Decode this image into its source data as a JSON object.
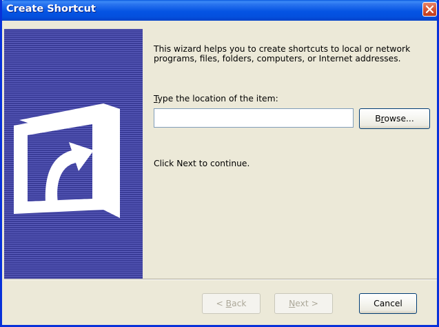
{
  "window": {
    "title": "Create Shortcut",
    "accent": "#0554e3",
    "close_color": "#d85a3a"
  },
  "banner": {
    "icon": "shortcut-arrow-icon",
    "color": "#3a3c98"
  },
  "main": {
    "intro": "This wizard helps you to create shortcuts to local or network programs, files, folders, computers, or Internet addresses.",
    "location_label_first": "T",
    "location_label_rest": "ype the location of the item:",
    "location_value": "",
    "browse_label_pre": "B",
    "browse_label_u": "r",
    "browse_label_post": "owse...",
    "continue_text": "Click Next to continue."
  },
  "footer": {
    "back_prefix": "< ",
    "back_u": "B",
    "back_rest": "ack",
    "next_u": "N",
    "next_rest": "ext >",
    "cancel_label": "Cancel"
  }
}
